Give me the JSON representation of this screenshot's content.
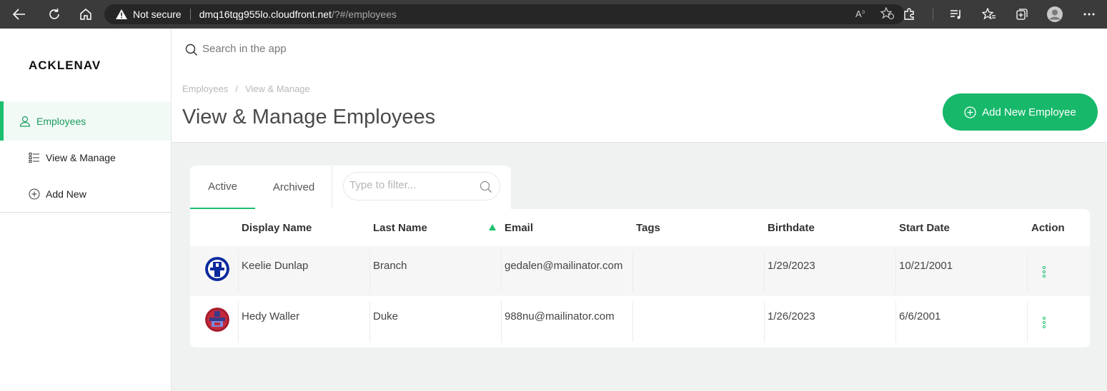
{
  "browser": {
    "security_label": "Not secure",
    "url_host": "dmq16tqg955lo.cloudfront.net",
    "url_path": "/?#/employees"
  },
  "sidebar": {
    "logo": "ACKLENAVENUE",
    "items": [
      {
        "label": "Employees",
        "icon": "user-icon",
        "active": true
      },
      {
        "label": "View & Manage",
        "icon": "list-icon"
      },
      {
        "label": "Add New",
        "icon": "plus-circle-icon"
      }
    ]
  },
  "search": {
    "placeholder": "Search in the app"
  },
  "breadcrumb": [
    "Employees",
    "View & Manage"
  ],
  "page_title": "View & Manage Employees",
  "add_button_label": "Add New Employee",
  "tabs": [
    {
      "label": "Active",
      "active": true
    },
    {
      "label": "Archived"
    }
  ],
  "filter": {
    "placeholder": "Type to filter..."
  },
  "table": {
    "columns": [
      "Display Name",
      "Last Name",
      "Email",
      "Tags",
      "Birthdate",
      "Start Date",
      "Action"
    ],
    "sorted_column": "Last Name",
    "rows": [
      {
        "display_name": "Keelie Dunlap",
        "last_name": "Branch",
        "email": "gedalen@mailinator.com",
        "tags": "",
        "birthdate": "1/29/2023",
        "start_date": "10/21/2001"
      },
      {
        "display_name": "Hedy Waller",
        "last_name": "Duke",
        "email": "988nu@mailinator.com",
        "tags": "",
        "birthdate": "1/26/2023",
        "start_date": "6/6/2001"
      }
    ]
  },
  "colors": {
    "accent": "#17b86a",
    "chrome": "#3b3b3b",
    "content_bg": "#f0f2f2"
  }
}
